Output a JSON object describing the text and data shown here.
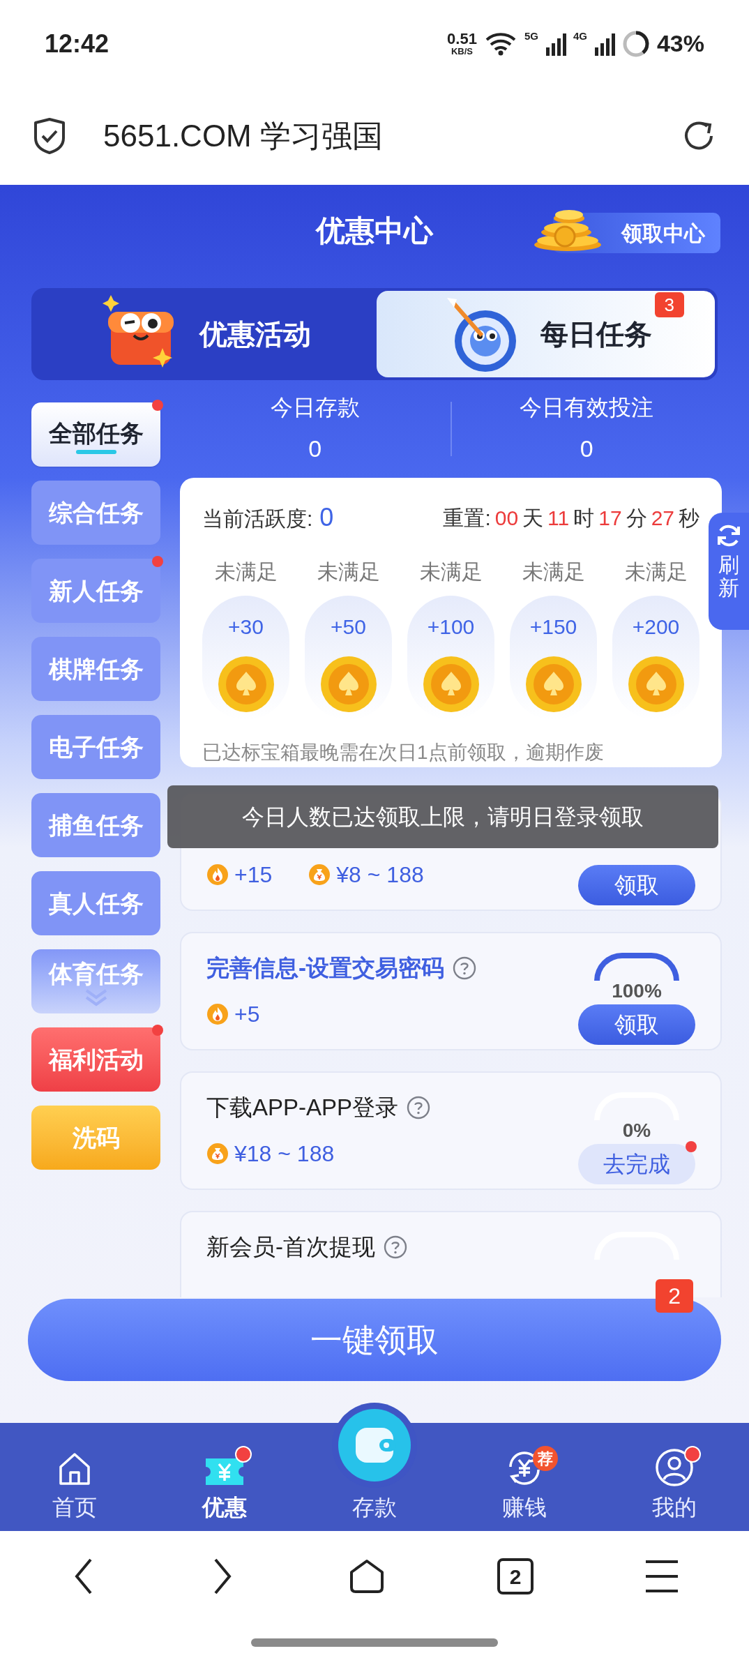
{
  "status_bar": {
    "time": "12:42",
    "speed": "0.51",
    "speed_unit": "KB/S",
    "network_1": "5G",
    "network_2": "4G",
    "battery": "43%"
  },
  "browser_bar": {
    "url": "5651.COM 学习强国"
  },
  "header": {
    "title": "优惠中心",
    "claim_center": "领取中心"
  },
  "tabs": [
    {
      "label": "优惠活动",
      "selected": false,
      "kind": "gift"
    },
    {
      "label": "每日任务",
      "selected": true,
      "kind": "target",
      "badge": "3"
    }
  ],
  "sidebar": [
    {
      "label": "全部任务",
      "kind": "task",
      "selected": true,
      "dot": true
    },
    {
      "label": "综合任务",
      "kind": "task",
      "selected": false,
      "dot": false
    },
    {
      "label": "新人任务",
      "kind": "task",
      "selected": false,
      "dot": true
    },
    {
      "label": "棋牌任务",
      "kind": "task",
      "selected": false,
      "dot": false
    },
    {
      "label": "电子任务",
      "kind": "task",
      "selected": false,
      "dot": false
    },
    {
      "label": "捕鱼任务",
      "kind": "task",
      "selected": false,
      "dot": false
    },
    {
      "label": "真人任务",
      "kind": "task",
      "selected": false,
      "dot": false
    },
    {
      "label": "体育任务",
      "kind": "more",
      "selected": false,
      "dot": false
    },
    {
      "label": "福利活动",
      "kind": "welfare",
      "selected": false,
      "dot": true
    },
    {
      "label": "洗码",
      "kind": "rebate",
      "selected": false,
      "dot": false
    }
  ],
  "stats": [
    {
      "label": "今日存款",
      "value": "0"
    },
    {
      "label": "今日有效投注",
      "value": "0"
    }
  ],
  "activity": {
    "label": "当前活跃度:",
    "value": "0",
    "reset_label": "重置:",
    "countdown": [
      {
        "value": "00",
        "unit": "天"
      },
      {
        "value": "11",
        "unit": "时"
      },
      {
        "value": "17",
        "unit": "分"
      },
      {
        "value": "27",
        "unit": "秒"
      }
    ],
    "milestones": [
      {
        "status": "未满足",
        "points": "+30"
      },
      {
        "status": "未满足",
        "points": "+50"
      },
      {
        "status": "未满足",
        "points": "+100"
      },
      {
        "status": "未满足",
        "points": "+150"
      },
      {
        "status": "未满足",
        "points": "+200"
      }
    ],
    "note": "已达标宝箱最晚需在次日1点前领取，逾期作废"
  },
  "refresh": "刷新",
  "tasks": [
    {
      "rewards": [
        {
          "kind": "fire",
          "text": "+15"
        },
        {
          "kind": "bag",
          "text": "¥8 ~ 188"
        }
      ],
      "button": {
        "label": "领取",
        "kind": "claim",
        "dot": false
      }
    },
    {
      "title": "完善信息-设置交易密码",
      "rewards": [
        {
          "kind": "fire",
          "text": "+5"
        }
      ],
      "complete": true,
      "percent": "100%",
      "button": {
        "label": "领取",
        "kind": "claim",
        "dot": false
      }
    },
    {
      "title": "下载APP-APP登录",
      "rewards": [
        {
          "kind": "bag",
          "text": "¥18 ~ 188"
        }
      ],
      "complete": false,
      "percent": "0%",
      "button": {
        "label": "去完成",
        "kind": "go",
        "dot": true
      }
    },
    {
      "title": "新会员-首次提现",
      "complete": false
    }
  ],
  "toast": "今日人数已达领取上限，请明日登录领取",
  "claim_all": {
    "label": "一键领取",
    "badge": "2"
  },
  "bottom_nav": [
    {
      "label": "首页",
      "kind": "home",
      "selected": false
    },
    {
      "label": "优惠",
      "kind": "offers",
      "selected": true,
      "dot": true
    },
    {
      "label": "存款",
      "kind": "deposit",
      "selected": false
    },
    {
      "label": "赚钱",
      "kind": "earn",
      "selected": false,
      "badge": "荐"
    },
    {
      "label": "我的",
      "kind": "profile",
      "selected": false,
      "dot": true
    }
  ],
  "browser_nav": {
    "tabs_count": "2"
  }
}
